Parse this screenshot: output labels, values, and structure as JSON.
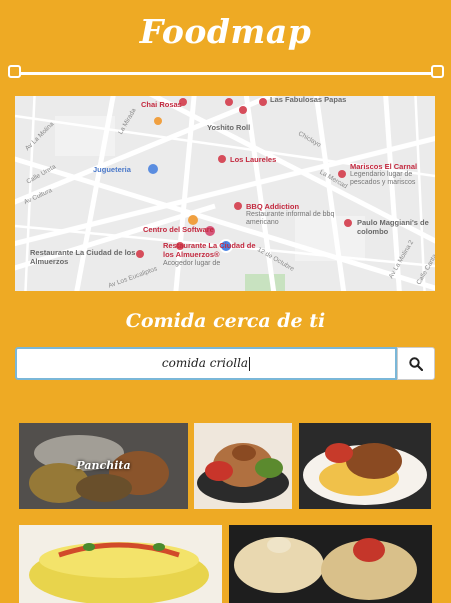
{
  "app": {
    "title": "Foodmap"
  },
  "map": {
    "places": [
      {
        "name": "Chai Rosas"
      },
      {
        "name": "Las Fabulosas Papas"
      },
      {
        "name": "Yoshito Roll"
      },
      {
        "name": "Jugueteria"
      },
      {
        "name": "Los Laureles"
      },
      {
        "name": "Mariscos El Carnal",
        "desc": "Legendario lugar de pescados y mariscos"
      },
      {
        "name": "BBQ Addiction",
        "desc": "Restaurante informal de bbq americano"
      },
      {
        "name": "Centro del Software"
      },
      {
        "name": "Paulo Maggiani's de colombo"
      },
      {
        "name": "Restaurante La Ciudad de los Almuerzos"
      },
      {
        "name": "Restaurante La Ciudad de los Almuerzos®",
        "desc": "Acogedor lugar de"
      }
    ],
    "streets": [
      "Av La Molina",
      "Calle Ureta",
      "Av Cultura",
      "La Mirada",
      "Chiclayo",
      "12 de Octubre",
      "Av Los Eucaliptos",
      "La Mercad",
      "Av La Molina 2",
      "Calle Canta"
    ]
  },
  "section": {
    "title": "Comida cerca de ti"
  },
  "search": {
    "value": "comida criolla",
    "icon": "search-icon"
  },
  "results": [
    {
      "caption": "Panchita"
    },
    {
      "caption": ""
    },
    {
      "caption": ""
    },
    {
      "caption": ""
    },
    {
      "caption": ""
    }
  ],
  "colors": {
    "background": "#eeaa24",
    "accent": "#7ab7d8"
  }
}
